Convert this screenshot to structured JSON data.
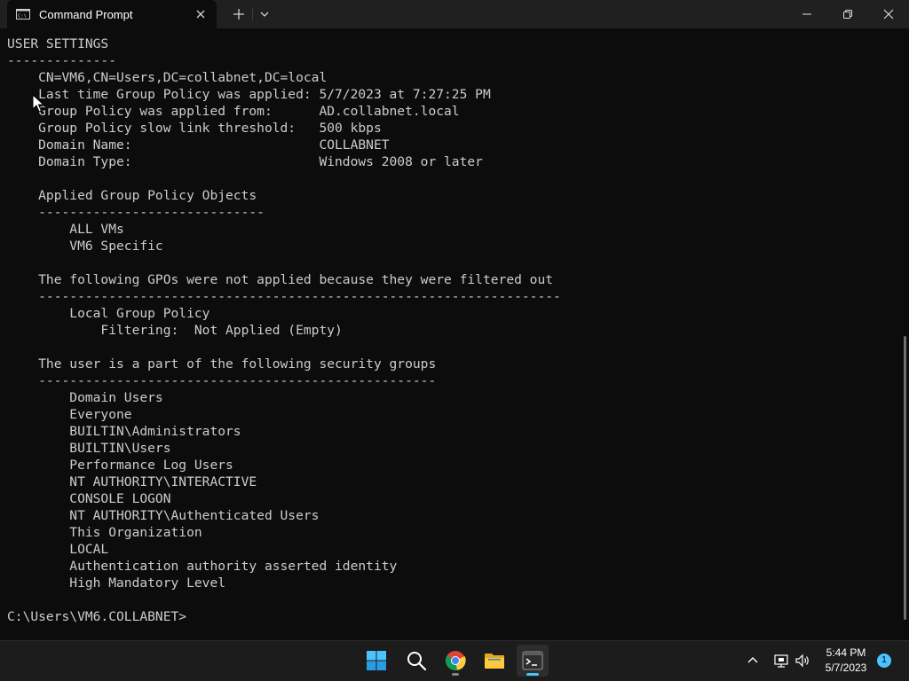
{
  "window": {
    "tab_title": "Command Prompt"
  },
  "terminal": {
    "lines": [
      "USER SETTINGS",
      "--------------",
      "    CN=VM6,CN=Users,DC=collabnet,DC=local",
      "    Last time Group Policy was applied: 5/7/2023 at 7:27:25 PM",
      "    Group Policy was applied from:      AD.collabnet.local",
      "    Group Policy slow link threshold:   500 kbps",
      "    Domain Name:                        COLLABNET",
      "    Domain Type:                        Windows 2008 or later",
      "",
      "    Applied Group Policy Objects",
      "    -----------------------------",
      "        ALL VMs",
      "        VM6 Specific",
      "",
      "    The following GPOs were not applied because they were filtered out",
      "    -------------------------------------------------------------------",
      "        Local Group Policy",
      "            Filtering:  Not Applied (Empty)",
      "",
      "    The user is a part of the following security groups",
      "    ---------------------------------------------------",
      "        Domain Users",
      "        Everyone",
      "        BUILTIN\\Administrators",
      "        BUILTIN\\Users",
      "        Performance Log Users",
      "        NT AUTHORITY\\INTERACTIVE",
      "        CONSOLE LOGON",
      "        NT AUTHORITY\\Authenticated Users",
      "        This Organization",
      "        LOCAL",
      "        Authentication authority asserted identity",
      "        High Mandatory Level",
      "",
      "C:\\Users\\VM6.COLLABNET>"
    ]
  },
  "taskbar": {
    "apps": [
      {
        "name": "start-button",
        "icon": "windows-logo-icon",
        "running": false
      },
      {
        "name": "search-button",
        "icon": "search-icon",
        "running": false
      },
      {
        "name": "chrome-app",
        "icon": "chrome-icon",
        "running": true
      },
      {
        "name": "file-explorer-app",
        "icon": "folder-icon",
        "running": false
      },
      {
        "name": "terminal-app",
        "icon": "terminal-icon",
        "running": true,
        "active": true
      }
    ],
    "clock": {
      "time": "5:44 PM",
      "date": "5/7/2023"
    },
    "notification_count": "1"
  },
  "colors": {
    "terminal_bg": "#0c0c0c",
    "terminal_text": "#cccccc",
    "titlebar_bg": "#202020",
    "taskbar_bg": "#1c1c1c",
    "accent": "#4cc2ff"
  }
}
